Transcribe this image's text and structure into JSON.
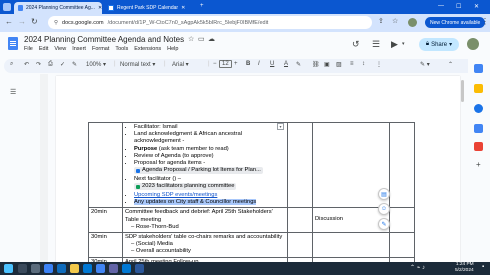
{
  "tabs": [
    {
      "label": "2024 Planning Committee Ag...",
      "active": true
    },
    {
      "label": "Regent Park SDP Calendar",
      "active": false
    }
  ],
  "address_bar": {
    "domain": "docs.google.com",
    "path": "/document/d/1P_W-CtoC7n0_sAgpAk5k5bIRrc_5lebjF0IBMfE/edit"
  },
  "chrome_notice": "New Chrome available",
  "document": {
    "title": "2024 Planning Committee Agenda and Notes",
    "menus": [
      "File",
      "Edit",
      "View",
      "Insert",
      "Format",
      "Tools",
      "Extensions",
      "Help"
    ],
    "share_label": "Share"
  },
  "toolbar": {
    "zoom": "100%",
    "style": "Normal text",
    "font": "Arial",
    "font_size": "12"
  },
  "table": {
    "row1": {
      "facilitator": "Facilitator: Ismail",
      "land_ack": "Land acknowledgment & African ancestral acknowledgement -",
      "purpose_bold": "Purpose",
      "purpose_rest": " (ask team member to read)",
      "review": "Review of Agenda (to approve)",
      "proposal": "Proposal for agenda items -",
      "proposal_chip": "Agenda Proposal / Parking lot Items for Plan...",
      "next_fac": "Next facilitator () –",
      "fac_chip": "2023 facilitators planning committee",
      "sdp_link": "Upcoming SDP events/meetings",
      "updates_hl": "Any updates on City staff & Councillor meetings"
    },
    "row2": {
      "time": "20min",
      "text": "Committee feedback and debrief: April 25th Stakeholders' Table meeting",
      "sub": "Rose-Thorn-Bud",
      "col4": "Discussion"
    },
    "row3": {
      "time": "30min",
      "text": "SDP stakeholders' table co-chairs remarks and accountability",
      "sub1": "(Social) Media",
      "sub2": "Overall accountability"
    },
    "row4": {
      "time": "30min",
      "text": "April 25th meeting Follow-up"
    }
  },
  "clock": {
    "time": "1:24 PM",
    "date": "5/2/2024"
  }
}
